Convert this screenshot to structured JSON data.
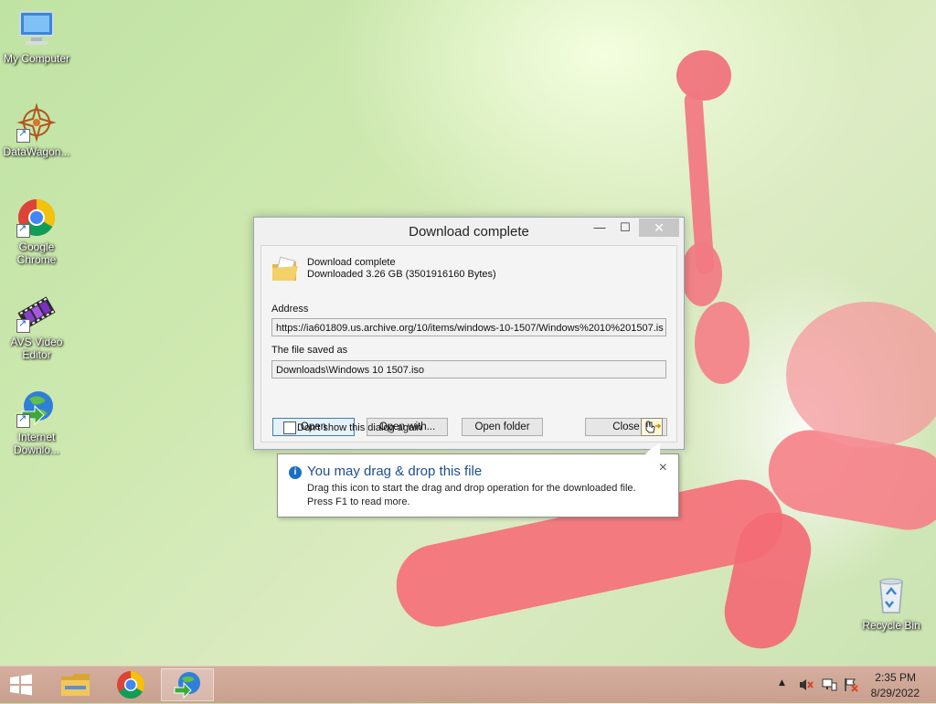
{
  "desktop": {
    "icons": [
      {
        "label": "My Computer"
      },
      {
        "label": "DataWagon..."
      },
      {
        "label": "Google Chrome"
      },
      {
        "label": "AVS Video Editor"
      },
      {
        "label": "Internet Downlo..."
      },
      {
        "label": "Recycle Bin"
      }
    ]
  },
  "dialog": {
    "title": "Download complete",
    "minimize_glyph": "—",
    "maximize_glyph": "☐",
    "close_glyph": "✕",
    "heading": "Download complete",
    "size_text": "Downloaded 3.26  GB (3501916160 Bytes)",
    "address_label": "Address",
    "address_value": "https://ia601809.us.archive.org/10/items/windows-10-1507/Windows%2010%201507.is",
    "saved_label": "The file saved as",
    "saved_value": "Downloads\\Windows 10 1507.iso",
    "buttons": {
      "open": "Open",
      "open_with": "Open with...",
      "open_folder": "Open folder",
      "close": "Close"
    },
    "checkbox_label": "Don't show this dialog again"
  },
  "tooltip": {
    "info_glyph": "i",
    "title": "You may drag & drop this file",
    "line1": "Drag this icon to start the drag and drop operation for the downloaded file.",
    "line2": "Press F1 to read more.",
    "close_glyph": "×"
  },
  "taskbar": {
    "tray_arrow": "▲",
    "time": "2:35 PM",
    "date": "8/29/2022"
  },
  "colors": {
    "taskbar": "#c9a08f",
    "info_blue": "#1a6fc0",
    "tooltip_title": "#1f4e8c",
    "chrome_red": "#db4437",
    "chrome_yellow": "#f4c20d",
    "chrome_green": "#0f9d58",
    "chrome_blue": "#4285f4"
  }
}
